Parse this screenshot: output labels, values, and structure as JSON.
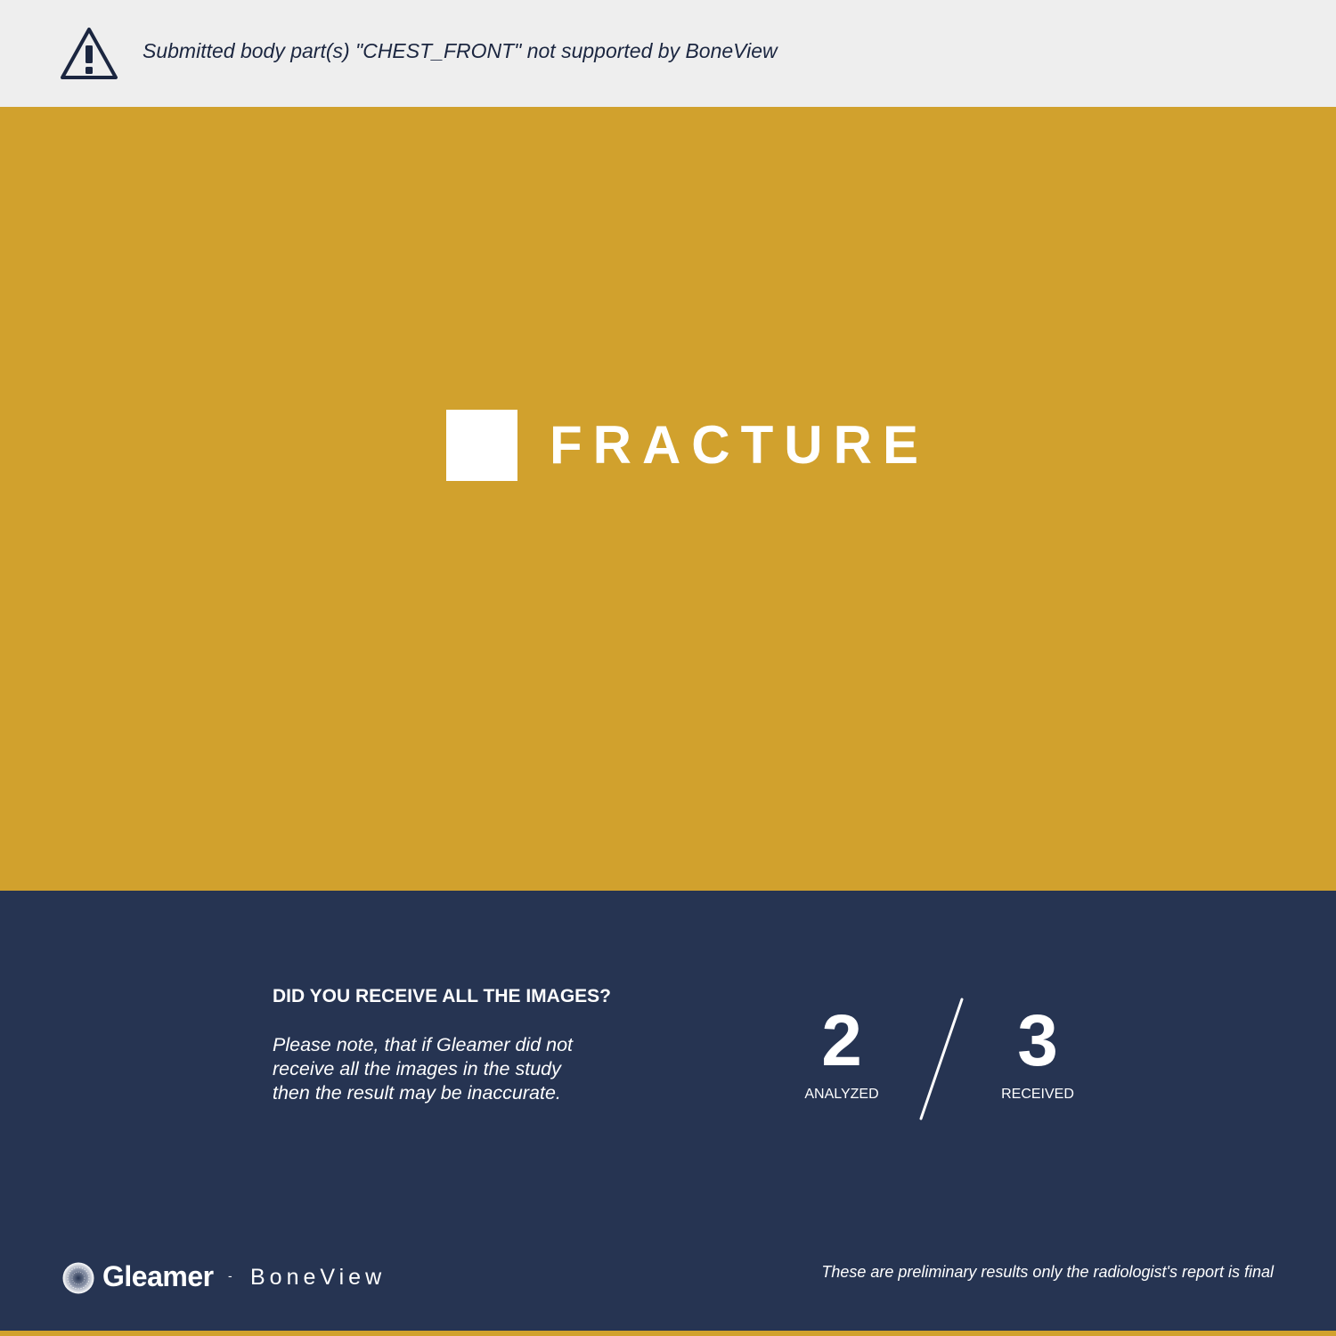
{
  "warning": {
    "icon": "warning-triangle-icon",
    "message": "Submitted body part(s) \"CHEST_FRONT\" not supported by BoneView"
  },
  "result": {
    "label": "FRACTURE",
    "color": "#d1a12d"
  },
  "images_check": {
    "heading": "DID YOU RECEIVE ALL THE IMAGES?",
    "note": "Please note, that if Gleamer did not receive all the images in the study then the result may be inaccurate.",
    "analyzed": {
      "value": "2",
      "label": "ANALYZED"
    },
    "received": {
      "value": "3",
      "label": "RECEIVED"
    }
  },
  "footer": {
    "brand": "Gleamer",
    "separator": "-",
    "product": "BoneView",
    "disclaimer": "These are preliminary results only the radiologist's report is final",
    "logo_icon": "gleamer-logo-icon"
  },
  "colors": {
    "warning_bg": "#eeeeee",
    "result_bg": "#d1a12d",
    "info_bg": "#263452",
    "text_dark": "#1b2640"
  }
}
